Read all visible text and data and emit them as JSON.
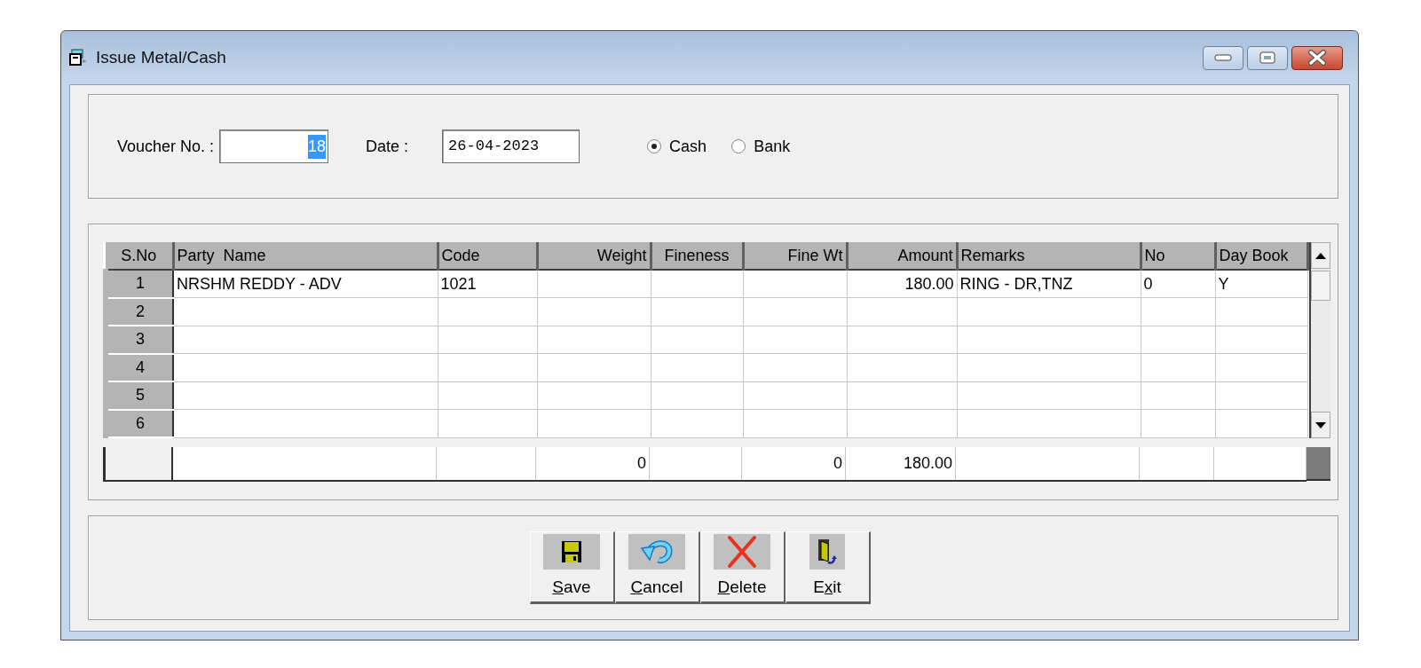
{
  "window": {
    "title": "Issue Metal/Cash"
  },
  "voucher": {
    "label": "Voucher No. :",
    "value": "18",
    "highlighted": true
  },
  "date": {
    "label": "Date :",
    "value": "26-04-2023"
  },
  "payment_mode": [
    {
      "label": "Cash",
      "selected": true
    },
    {
      "label": "Bank",
      "selected": false
    }
  ],
  "table": {
    "columns": [
      "S.No",
      "Party  Name",
      "Code",
      "Weight",
      "Fineness",
      "Fine Wt",
      "Amount",
      "Remarks",
      "No",
      "Day Book"
    ],
    "rows": [
      [
        "1",
        "NRSHM REDDY - ADV",
        "1021",
        "",
        "",
        "",
        "180.00",
        "RING - DR,TNZ",
        "0",
        "Y"
      ],
      [
        "2",
        "",
        "",
        "",
        "",
        "",
        "",
        "",
        "",
        ""
      ],
      [
        "3",
        "",
        "",
        "",
        "",
        "",
        "",
        "",
        "",
        ""
      ],
      [
        "4",
        "",
        "",
        "",
        "",
        "",
        "",
        "",
        "",
        ""
      ],
      [
        "5",
        "",
        "",
        "",
        "",
        "",
        "",
        "",
        "",
        ""
      ],
      [
        "6",
        "",
        "",
        "",
        "",
        "",
        "",
        "",
        "",
        ""
      ]
    ],
    "totals": {
      "weight": "0",
      "fine_wt": "0",
      "amount": "180.00"
    }
  },
  "buttons": [
    {
      "kind": "save",
      "accel": "S",
      "post": "ave"
    },
    {
      "kind": "cancel",
      "accel": "C",
      "post": "ancel"
    },
    {
      "kind": "delete",
      "accel": "D",
      "post": "elete"
    },
    {
      "kind": "exit",
      "pre": "E",
      "accel": "x",
      "post": "it"
    }
  ]
}
